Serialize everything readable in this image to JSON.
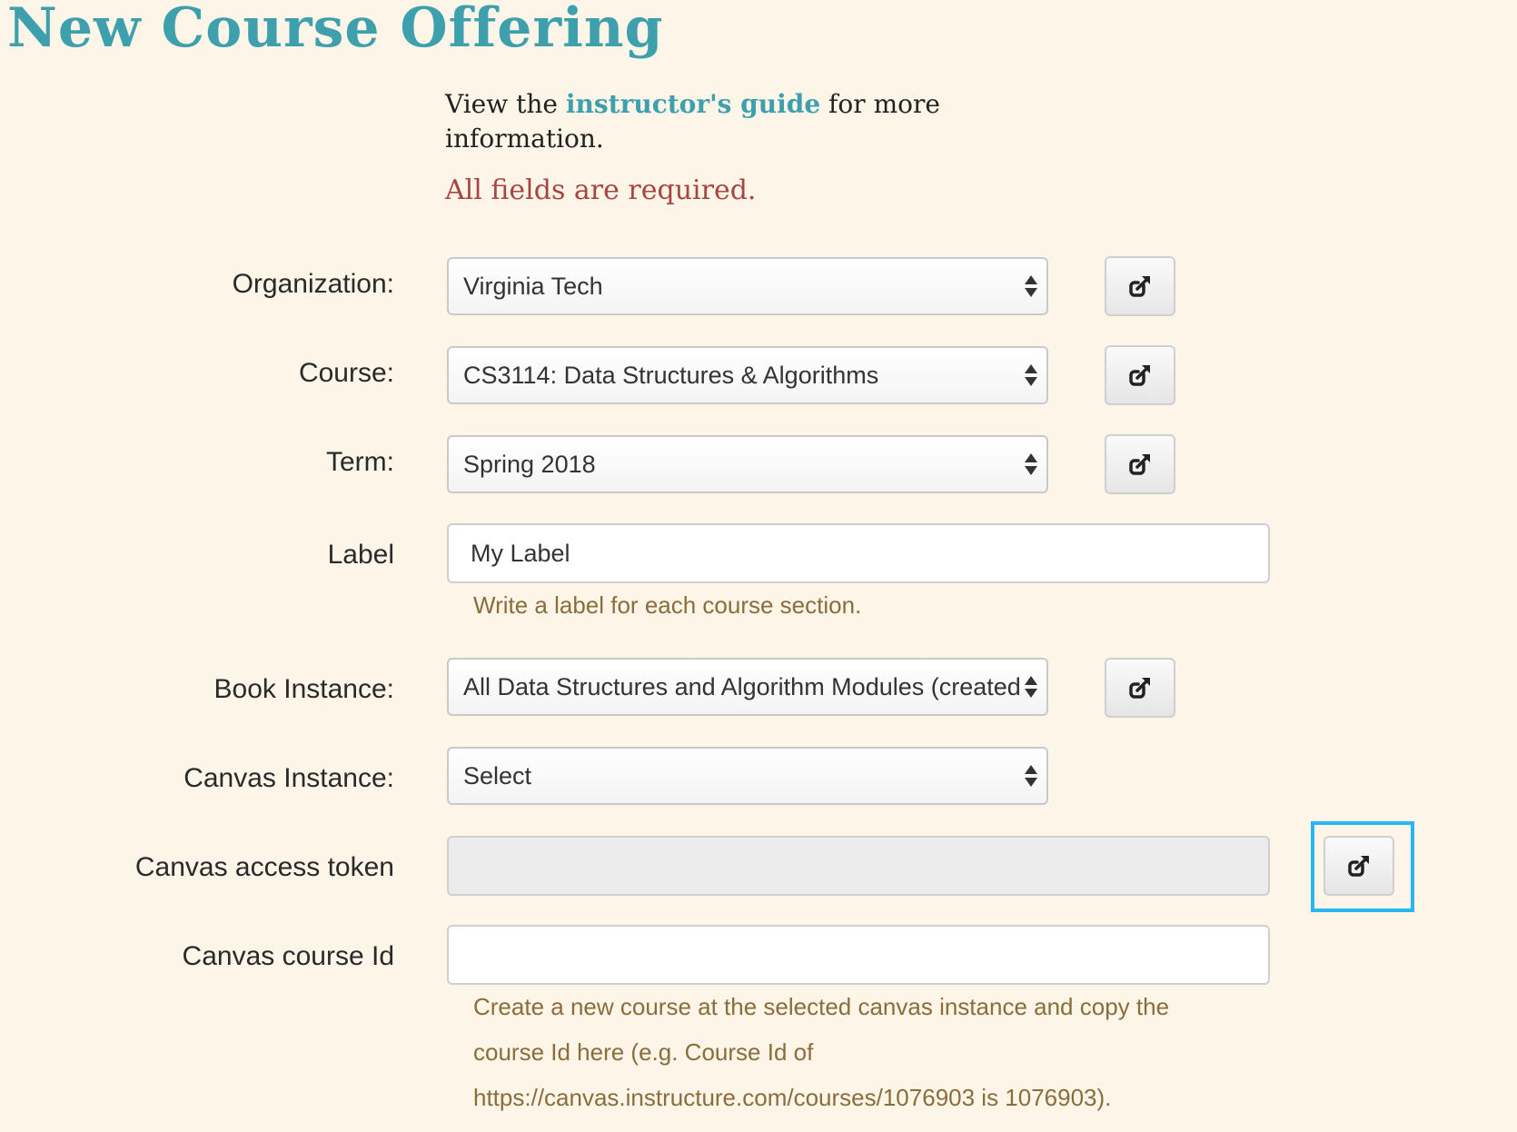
{
  "page": {
    "title": "New Course Offering"
  },
  "intro": {
    "prefix": "View the ",
    "link": "instructor's guide",
    "suffix": " for more information.",
    "required": "All fields are required."
  },
  "form": {
    "organization": {
      "label": "Organization:",
      "value": "Virginia Tech"
    },
    "course": {
      "label": "Course:",
      "value": "CS3114: Data Structures & Algorithms"
    },
    "term": {
      "label": "Term:",
      "value": "Spring 2018"
    },
    "label_field": {
      "label": "Label",
      "value": "My Label",
      "help": "Write a label for each course section."
    },
    "book_instance": {
      "label": "Book Instance:",
      "value": "All Data Structures and Algorithm Modules (created"
    },
    "canvas_instance": {
      "label": "Canvas Instance:",
      "value": "Select"
    },
    "canvas_token": {
      "label": "Canvas access token",
      "value": ""
    },
    "canvas_course_id": {
      "label": "Canvas course Id",
      "value": "",
      "help_line1": "Create a new course at the selected canvas instance and copy the",
      "help_line2": "course Id here (e.g. Course Id of",
      "help_line3": "https://canvas.instructure.com/courses/1076903 is 1076903)."
    }
  },
  "icons": {
    "external": "external-link-icon",
    "select_caret": "select-caret-icon"
  },
  "colors": {
    "background": "#fdf5e8",
    "title": "#3fa0ad",
    "required": "#a94442",
    "help": "#8a6d3b",
    "highlight": "#29b6f6"
  }
}
